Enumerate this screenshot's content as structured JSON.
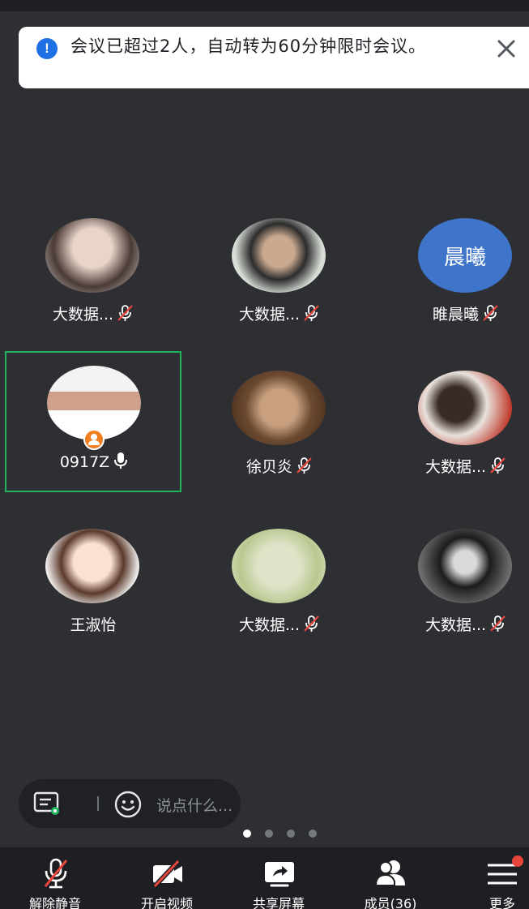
{
  "topbar": {
    "text": " "
  },
  "banner": {
    "message": "会议已超过2人，自动转为60分钟限时会议。",
    "info_icon": "exclamation-icon",
    "close_icon": "close-icon"
  },
  "participants": [
    {
      "name": "大数据...",
      "avatar": "photo",
      "mic": "muted"
    },
    {
      "name": "大数据...",
      "avatar": "photo",
      "mic": "muted"
    },
    {
      "name": "睢晨曦",
      "avatar": "text",
      "avatar_text": "晨曦",
      "mic": "muted"
    },
    {
      "name": "0917Z",
      "avatar": "photo",
      "mic": "on",
      "host": true,
      "active": true
    },
    {
      "name": "徐贝炎",
      "avatar": "photo",
      "mic": "muted"
    },
    {
      "name": "大数据...",
      "avatar": "photo",
      "mic": "muted"
    },
    {
      "name": "王淑怡",
      "avatar": "photo",
      "mic": "none"
    },
    {
      "name": "大数据...",
      "avatar": "photo",
      "mic": "muted"
    },
    {
      "name": "大数据...",
      "avatar": "photo",
      "mic": "muted"
    }
  ],
  "chat": {
    "placeholder": "说点什么..."
  },
  "pager": {
    "count": 4,
    "current": 1
  },
  "toolbar": {
    "unmute": "解除静音",
    "video": "开启视频",
    "share": "共享屏幕",
    "members": "成员(36)",
    "more": "更多"
  },
  "colors": {
    "background": "#2d2f33",
    "toolbar": "#1d1f22",
    "active_border": "#1fb35a",
    "muted_red": "#e8453c",
    "info_blue": "#1f6fe5",
    "host_orange": "#f07f22"
  }
}
